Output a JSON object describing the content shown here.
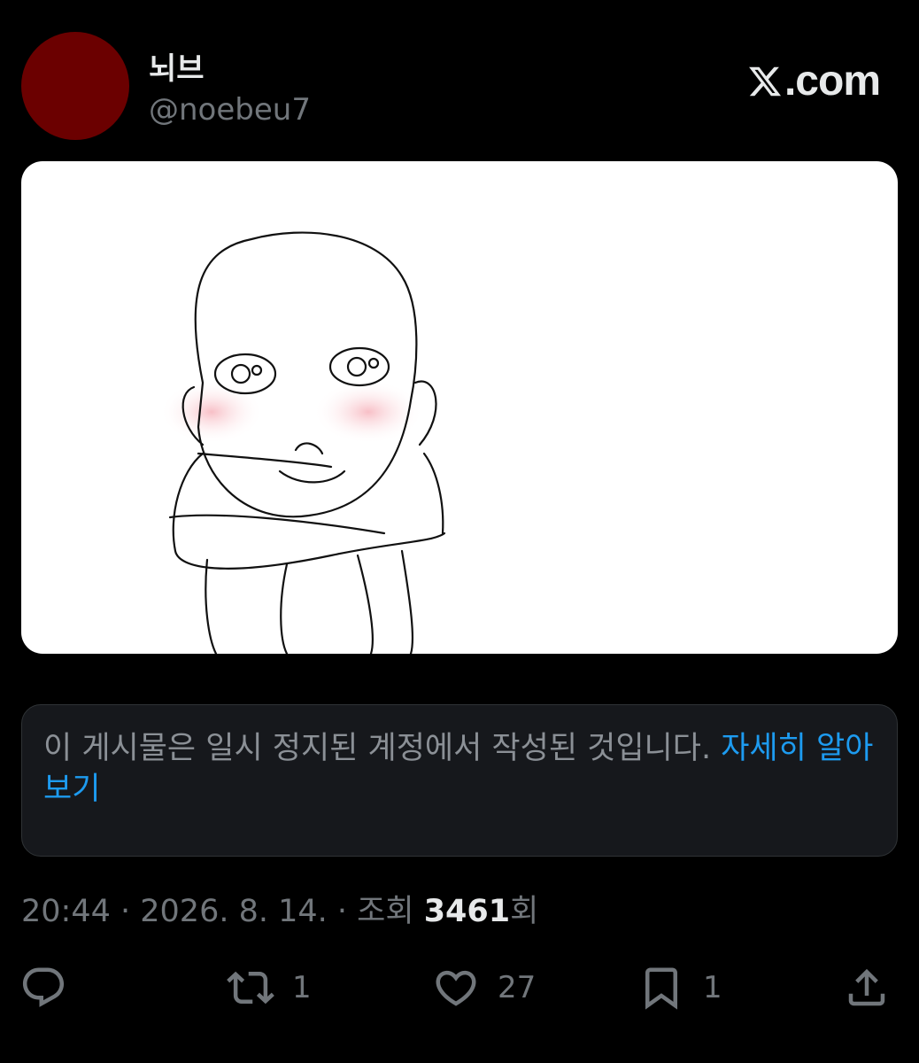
{
  "tweet": {
    "display_name": "뇌브",
    "handle": "@noebeu7",
    "avatar_color": "#6b0000",
    "brand": ".com",
    "media_icon": "drawing-of-bald-figure"
  },
  "notice": {
    "text": "이 게시물은 일시 정지된 계정에서 작성된 것입니다. ",
    "link": "자세히 알아보기",
    "link_color": "#1d9bf0"
  },
  "meta": {
    "time": "20:44",
    "separator": " · ",
    "date": "2026. 8. 14.",
    "views_label": "조회 ",
    "views_count": "3461",
    "views_suffix": "회"
  },
  "actions": {
    "reply_icon": "reply-icon",
    "retweet_count": "1",
    "like_count": "27",
    "bookmark_count": "1",
    "share_icon": "share-icon"
  }
}
